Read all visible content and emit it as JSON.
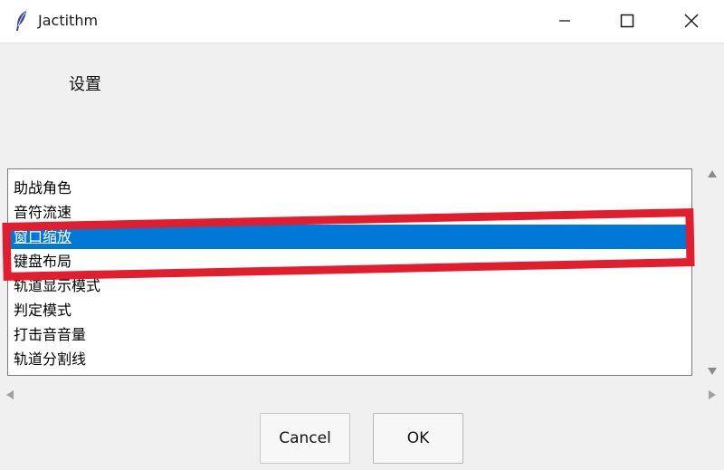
{
  "window": {
    "title": "Jactithm",
    "icon": "feather-icon"
  },
  "dialog": {
    "heading": "设置"
  },
  "list": {
    "items": [
      {
        "label": "助战角色",
        "selected": false
      },
      {
        "label": "音符流速",
        "selected": false
      },
      {
        "label": "窗口缩放",
        "selected": true
      },
      {
        "label": "键盘布局",
        "selected": false
      },
      {
        "label": "轨道显示模式",
        "selected": false
      },
      {
        "label": "判定模式",
        "selected": false
      },
      {
        "label": "打击音音量",
        "selected": false
      },
      {
        "label": "轨道分割线",
        "selected": false
      }
    ]
  },
  "buttons": {
    "cancel": "Cancel",
    "ok": "OK"
  },
  "colors": {
    "selection": "#0078d7",
    "annotation": "#e11d2e"
  }
}
